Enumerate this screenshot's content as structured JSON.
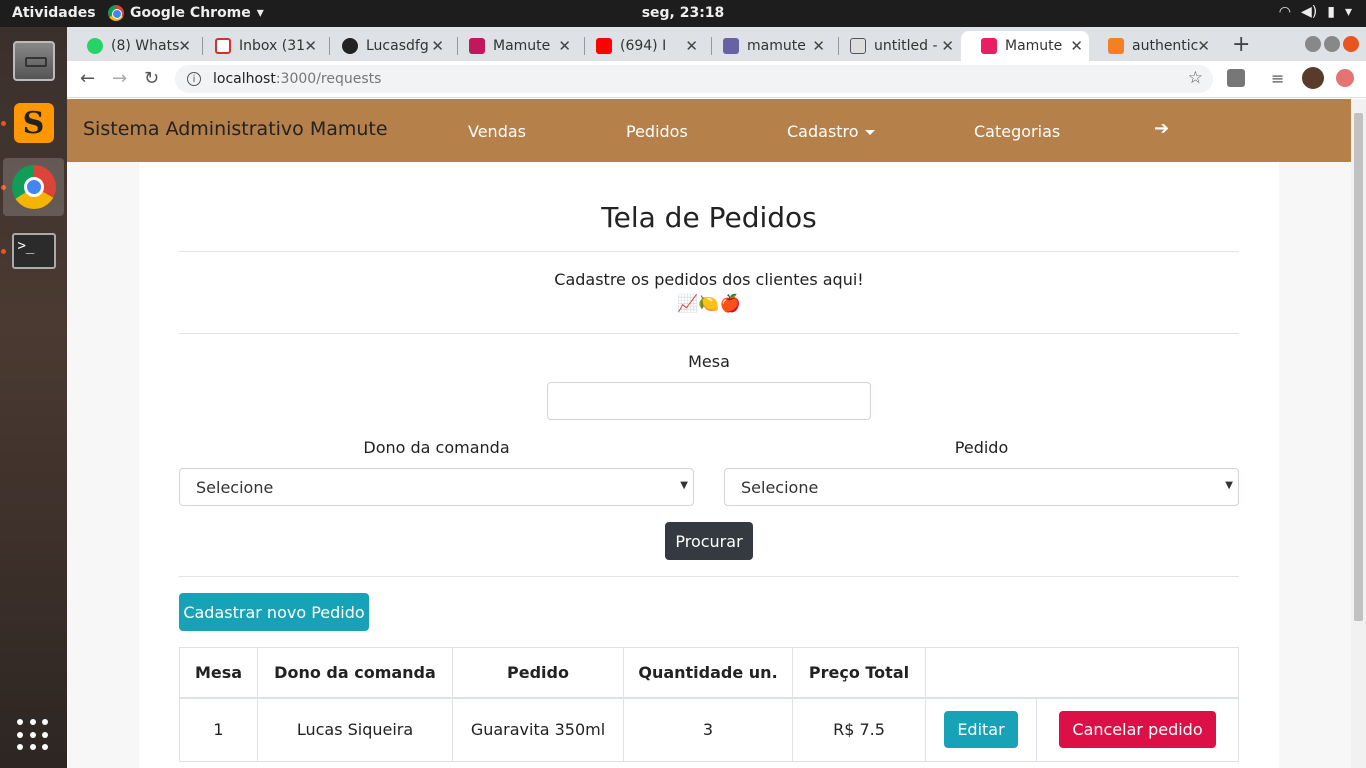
{
  "system": {
    "activities": "Atividades",
    "app_name": "Google Chrome",
    "clock": "seg, 23:18"
  },
  "browser": {
    "tabs": [
      {
        "title": "(8) Whats",
        "icon": "whatsapp-icon",
        "color": "#25d366"
      },
      {
        "title": "Inbox (31",
        "icon": "gmail-icon",
        "color": "#d93025"
      },
      {
        "title": "Lucasdfg",
        "icon": "github-icon",
        "color": "#222222"
      },
      {
        "title": "Mamute",
        "icon": "mamute-icon",
        "color": "#c2185b"
      },
      {
        "title": "(694) I",
        "icon": "youtube-icon",
        "color": "#ff0000"
      },
      {
        "title": "mamute",
        "icon": "heroku-icon",
        "color": "#6762a6"
      },
      {
        "title": "untitled -",
        "icon": "document-icon",
        "color": "#555555"
      },
      {
        "title": "Mamute",
        "icon": "mamute-icon",
        "color": "#e91e63"
      },
      {
        "title": "authentic",
        "icon": "stackoverflow-icon",
        "color": "#f48024"
      }
    ],
    "url_host": "localhost",
    "url_path": ":3000/requests"
  },
  "navbar": {
    "brand": "Sistema Administrativo Mamute",
    "links": [
      "Vendas",
      "Pedidos",
      "Cadastro",
      "Categorias"
    ],
    "color": "#b5804a"
  },
  "page": {
    "title": "Tela de Pedidos",
    "subtitle": "Cadastre os pedidos dos clientes aqui!",
    "emoji": "📈🍋🍎"
  },
  "form": {
    "mesa_label": "Mesa",
    "mesa_value": "",
    "owner_label": "Dono da comanda",
    "owner_selected": "Selecione",
    "order_label": "Pedido",
    "order_selected": "Selecione",
    "search_button": "Procurar",
    "new_button": "Cadastrar novo Pedido"
  },
  "table": {
    "headers": [
      "Mesa",
      "Dono da comanda",
      "Pedido",
      "Quantidade un.",
      "Preço Total"
    ],
    "rows": [
      {
        "mesa": "1",
        "owner": "Lucas Siqueira",
        "order": "Guaravita 350ml",
        "quantity": "3",
        "total": "R$ 7.5",
        "edit": "Editar",
        "cancel": "Cancelar pedido"
      }
    ]
  },
  "colors": {
    "primary_info": "#17a2b8",
    "danger": "#dc0f47",
    "dark": "#343a40"
  }
}
